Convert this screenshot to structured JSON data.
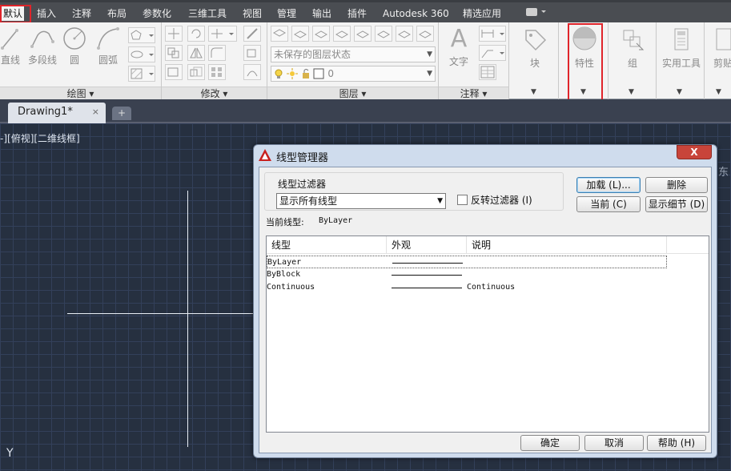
{
  "menubar": {
    "items": [
      {
        "label": "默认",
        "active": true
      },
      {
        "label": "插入"
      },
      {
        "label": "注释"
      },
      {
        "label": "布局"
      },
      {
        "label": "参数化"
      },
      {
        "label": "三维工具"
      },
      {
        "label": "视图"
      },
      {
        "label": "管理"
      },
      {
        "label": "输出"
      },
      {
        "label": "插件"
      },
      {
        "label": "Autodesk 360"
      },
      {
        "label": "精选应用"
      }
    ]
  },
  "ribbon": {
    "draw": {
      "title": "绘图",
      "tools": [
        {
          "label": "直线",
          "icon": "line-icon"
        },
        {
          "label": "多段线",
          "icon": "polyline-icon"
        },
        {
          "label": "圆",
          "icon": "circle-icon"
        },
        {
          "label": "圆弧",
          "icon": "arc-icon"
        }
      ]
    },
    "modify": {
      "title": "修改"
    },
    "layers": {
      "title": "图层",
      "layer_state": "未保存的图层状态",
      "current_layer": "0"
    },
    "annotation": {
      "title": "注释",
      "text_label": "文字"
    },
    "block": {
      "label": "块"
    },
    "properties": {
      "label": "特性"
    },
    "group": {
      "label": "组"
    },
    "utilities": {
      "label": "实用工具"
    },
    "clipboard": {
      "label": "剪贴"
    }
  },
  "tabs": {
    "drawing": "Drawing1*",
    "close": "×",
    "new": "+"
  },
  "canvas": {
    "view_label": "-][俯视][二维线框]",
    "ucs_y": "Y",
    "compass": "东"
  },
  "dialog": {
    "title": "线型管理器",
    "close": "X",
    "filter_group_label": "线型过滤器",
    "filter_value": "显示所有线型",
    "invert_filter_label": "反转过滤器 (I)",
    "invert_checked": false,
    "buttons": {
      "load": "加载 (L)...",
      "delete": "删除",
      "current": "当前 (C)",
      "show_details": "显示细节 (D)",
      "ok": "确定",
      "cancel": "取消",
      "help": "帮助 (H)"
    },
    "current_linetype_label": "当前线型:",
    "current_linetype_value": "ByLayer",
    "columns": [
      "线型",
      "外观",
      "说明"
    ],
    "rows": [
      {
        "name": "ByLayer",
        "has_line": true,
        "description": ""
      },
      {
        "name": "ByBlock",
        "has_line": true,
        "description": ""
      },
      {
        "name": "Continuous",
        "has_line": true,
        "description": "Continuous"
      }
    ]
  },
  "colors": {
    "highlight_red": "#e0242a",
    "canvas_bg": "#263040",
    "menubar_bg": "#4a4d52",
    "dialog_frame": "#cfdced"
  }
}
